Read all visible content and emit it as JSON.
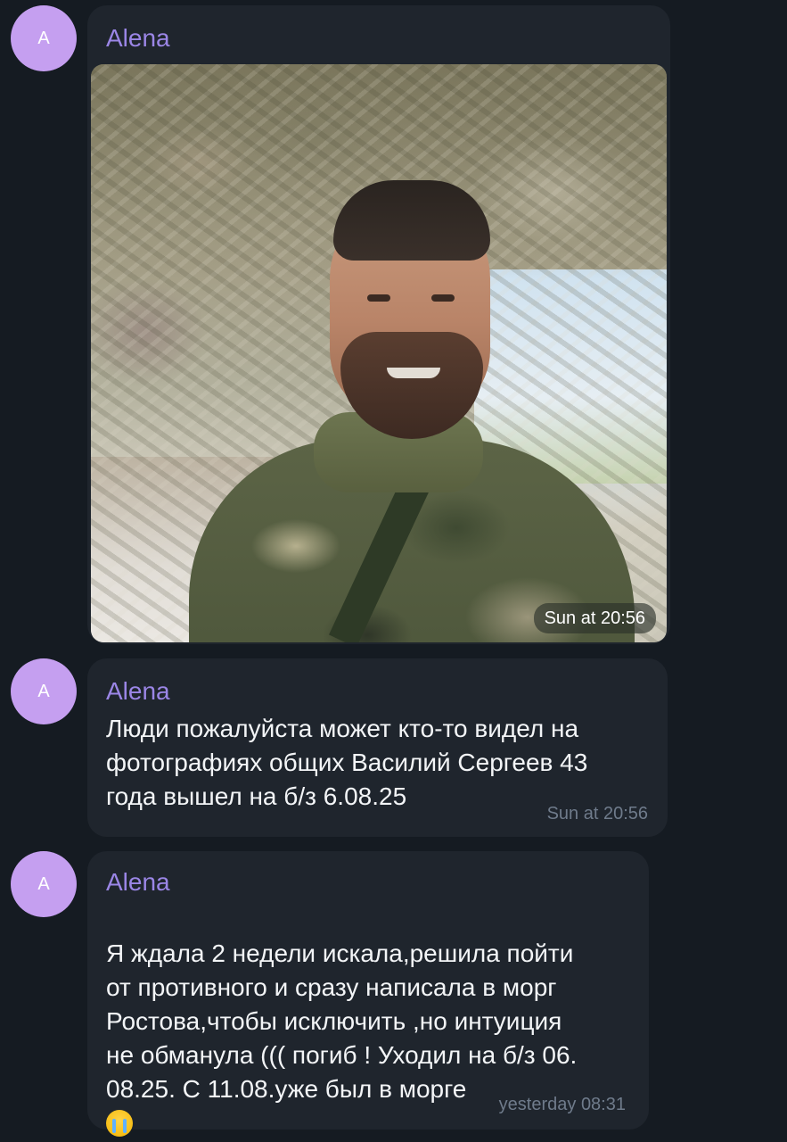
{
  "messages": [
    {
      "avatar_letter": "A",
      "sender": "Alena",
      "type": "photo",
      "time": "Sun at 20:56"
    },
    {
      "avatar_letter": "A",
      "sender": "Alena",
      "type": "text",
      "text": "Люди пожалуйста может кто-то видел на\nфотографиях общих Василий Сергеев 43\nгода вышел на б/з 6.08.25",
      "time": "Sun at 20:56"
    },
    {
      "avatar_letter": "A",
      "sender": "Alena",
      "type": "text",
      "text": "Я ждала 2 недели искала,решила пойти\nот противного и сразу написала в морг\nРостова,чтобы исключить ,но интуиция\nне обманула ((( погиб ! Уходил на б/з 06.\n08.25. С 11.08.уже был в морге",
      "emoji": "crying-face-emoji",
      "time": "yesterday 08:31"
    }
  ]
}
